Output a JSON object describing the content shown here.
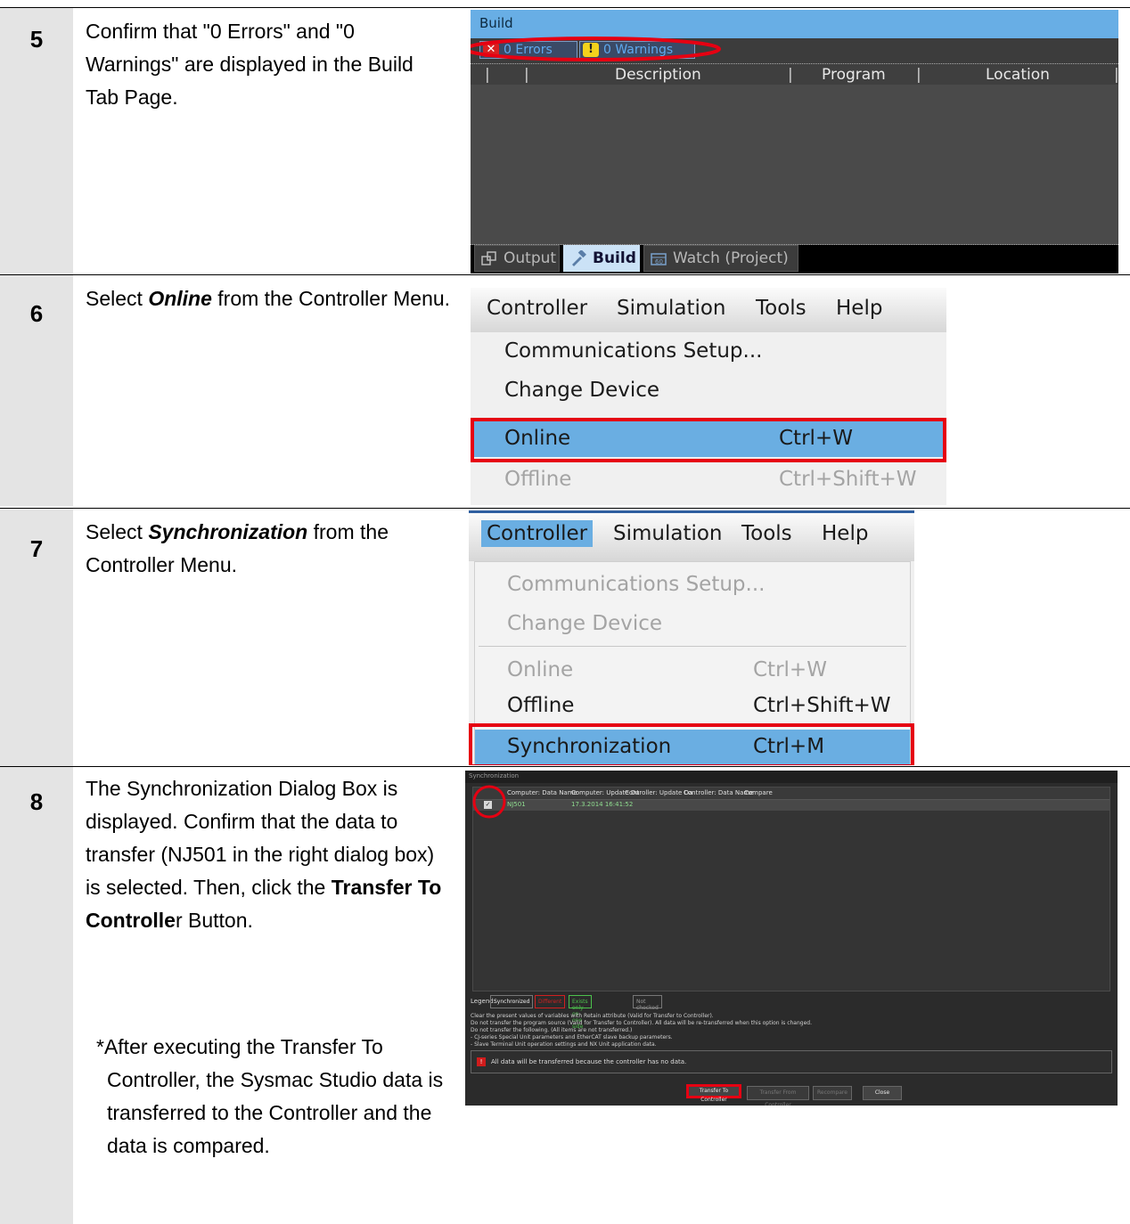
{
  "steps": [
    {
      "number": "5",
      "text": "Confirm that \"0 Errors\" and \"0 Warnings\" are displayed in the Build Tab Page."
    },
    {
      "number": "6",
      "text_before": "Select ",
      "text_em": "Online",
      "text_after": " from the Controller Menu."
    },
    {
      "number": "7",
      "text_before": "Select ",
      "text_em": "Synchronization",
      "text_after": " from the Controller Menu."
    },
    {
      "number": "8",
      "text_main": "The Synchronization Dialog Box is displayed. Confirm that the data to transfer (NJ501 in the right dialog box) is selected. Then, click the ",
      "text_button_bold": "Transfer To Controlle",
      "text_button_tail": "r Button.",
      "note": "*After executing the Transfer To Controller, the Sysmac Studio data is transferred to the Controller and the data is compared."
    }
  ],
  "build_pane": {
    "title": "Build",
    "errors_filter": "0  Errors",
    "warnings_filter": "0  Warnings",
    "columns": [
      "Description",
      "Program",
      "Location"
    ],
    "tabs": [
      "Output",
      "Build",
      "Watch (Project)"
    ],
    "active_tab": "Build"
  },
  "menu_online": {
    "menubar": [
      "Controller",
      "Simulation",
      "Tools",
      "Help"
    ],
    "items": [
      {
        "label": "Communications Setup...",
        "shortcut": "",
        "state": "enabled"
      },
      {
        "label": "Change Device",
        "shortcut": "",
        "state": "enabled"
      },
      {
        "label": "Online",
        "shortcut": "Ctrl+W",
        "state": "selected"
      },
      {
        "label": "Offline",
        "shortcut": "Ctrl+Shift+W",
        "state": "disabled"
      }
    ]
  },
  "menu_sync": {
    "menubar": [
      "Controller",
      "Simulation",
      "Tools",
      "Help"
    ],
    "items": [
      {
        "label": "Communications Setup...",
        "shortcut": "",
        "state": "disabled"
      },
      {
        "label": "Change Device",
        "shortcut": "",
        "state": "disabled"
      },
      {
        "label": "Online",
        "shortcut": "Ctrl+W",
        "state": "disabled"
      },
      {
        "label": "Offline",
        "shortcut": "Ctrl+Shift+W",
        "state": "enabled"
      },
      {
        "label": "Synchronization",
        "shortcut": "Ctrl+M",
        "state": "selected"
      }
    ]
  },
  "sync_dialog": {
    "title": "Synchronization",
    "columns": [
      "Computer: Data Name",
      "Computer: Update Da",
      "Controller: Update Da",
      "Controller: Data Name",
      "Compare"
    ],
    "row": {
      "name": "NJ501",
      "computer_update": "17.3.2014 16:41:52",
      "controller_update": "",
      "controller_name": "",
      "compare": ""
    },
    "legend_label": "Legend:",
    "legend": [
      "Synchronized",
      "Different",
      "Exists only on one side",
      "Not checked"
    ],
    "options": [
      "Clear the present values of variables with Retain attribute (Valid for Transfer to Controller).",
      "Do not transfer the program source (Valid for Transfer to Controller). All data will be re-transferred when this option is changed.",
      "Do not transfer the following. (All items are not transferred.)",
      "- CJ-series Special Unit parameters and EtherCAT slave backup parameters.",
      "- Slave Terminal Unit operation settings and NX Unit application data."
    ],
    "message": "All data will be transferred because the controller has no data.",
    "buttons": [
      "Transfer To Controller",
      "Transfer From Controller",
      "Recompare",
      "Close"
    ]
  },
  "colors": {
    "highlight_red": "#e60012",
    "menu_select_blue": "#6aaee2",
    "step_column_gray": "#e4e4e4"
  }
}
